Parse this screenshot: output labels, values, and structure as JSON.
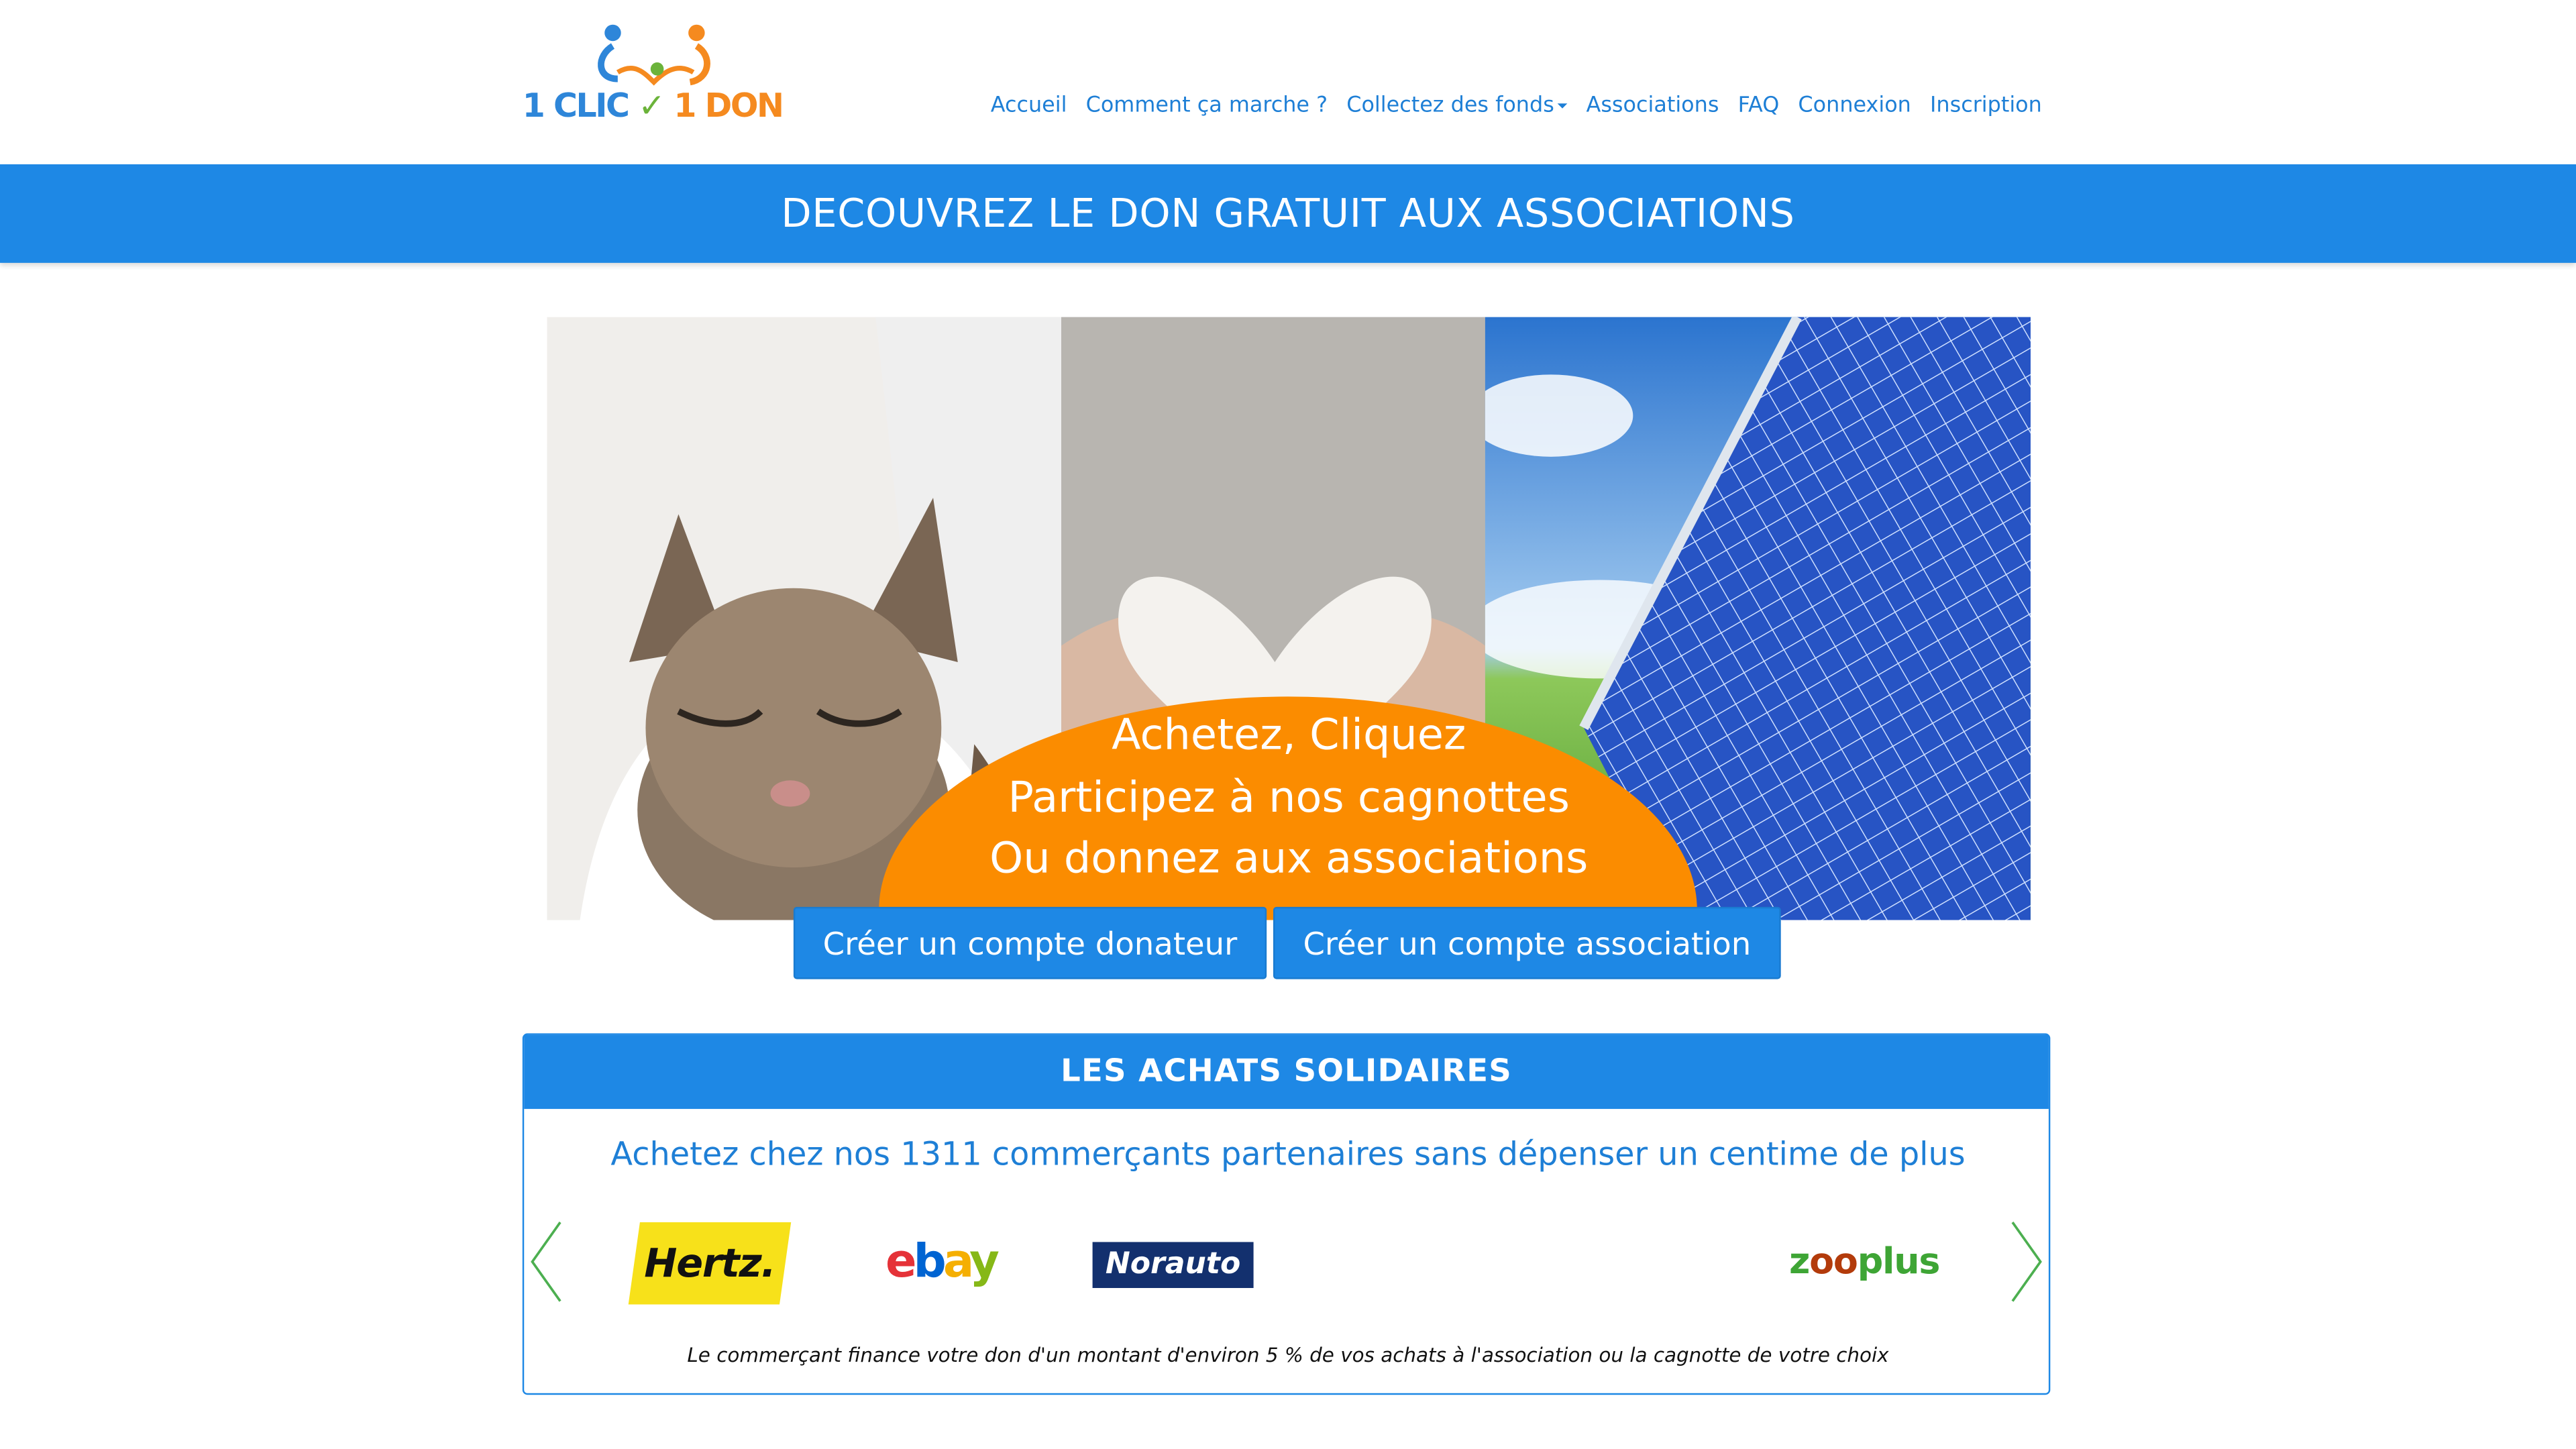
{
  "brand": {
    "logo_part1": "1 CLIC",
    "logo_part2": "1 DON",
    "accent_blue": "#1e88e5",
    "accent_orange": "#fb8c00"
  },
  "nav": {
    "items": [
      {
        "label": "Accueil"
      },
      {
        "label": "Comment ça marche ?"
      },
      {
        "label": "Collectez des fonds",
        "dropdown": true
      },
      {
        "label": "Associations"
      },
      {
        "label": "FAQ"
      },
      {
        "label": "Connexion"
      },
      {
        "label": "Inscription"
      }
    ]
  },
  "banner": {
    "title": "DECOUVREZ LE DON GRATUIT AUX ASSOCIATIONS"
  },
  "hero": {
    "line1": "Achetez, Cliquez",
    "line2": "Participez à nos cagnottes",
    "line3": "Ou donnez aux associations",
    "images": [
      "kitten-photo",
      "rice-heart-photo",
      "solar-panel-photo"
    ]
  },
  "actions": {
    "donor_button": "Créer un compte donateur",
    "association_button": "Créer un compte association"
  },
  "solidarity": {
    "title": "LES ACHATS SOLIDAIRES",
    "subtitle": "Achetez chez nos 1311 commerçants partenaires sans dépenser un centime de plus",
    "merchants": {
      "hertz": "Hertz.",
      "ebay": [
        "e",
        "b",
        "a",
        "y"
      ],
      "norauto": [
        "Norauto",
        "o"
      ],
      "zooplus": [
        "z",
        "oo",
        "plus"
      ]
    },
    "note": "Le commerçant finance votre don d'un montant d'environ 5 % de vos achats à l'association ou la cagnotte de votre choix"
  }
}
